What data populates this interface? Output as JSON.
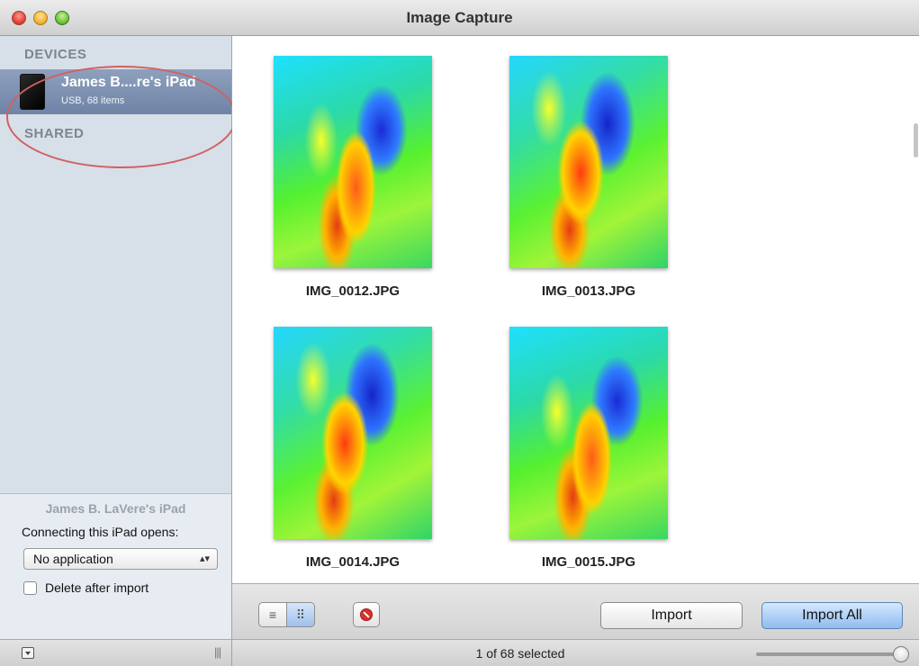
{
  "window": {
    "title": "Image Capture"
  },
  "sidebar": {
    "devices_heading": "DEVICES",
    "shared_heading": "SHARED",
    "device": {
      "name": "James B....re's iPad",
      "subtitle": "USB, 68 items",
      "icon": "ipad-icon"
    },
    "bottom": {
      "device_caption": "James B. LaVere's iPad",
      "opens_label": "Connecting this iPad opens:",
      "app_select_value": "No application",
      "delete_label": "Delete after import",
      "delete_checked": false
    }
  },
  "photos": [
    {
      "filename": "IMG_0012.JPG"
    },
    {
      "filename": "IMG_0013.JPG"
    },
    {
      "filename": "IMG_0014.JPG"
    },
    {
      "filename": "IMG_0015.JPG"
    }
  ],
  "toolbar": {
    "list_view_icon": "list-icon",
    "grid_view_icon": "grid-icon",
    "delete_icon": "no-entry-icon",
    "import_label": "Import",
    "import_all_label": "Import All"
  },
  "status": {
    "text": "1 of 68 selected",
    "thumbnail_size": 1.0
  },
  "colors": {
    "selection": "#7b8fb0",
    "import_all_button": "#9fc6f2",
    "annotation": "#d16060"
  }
}
